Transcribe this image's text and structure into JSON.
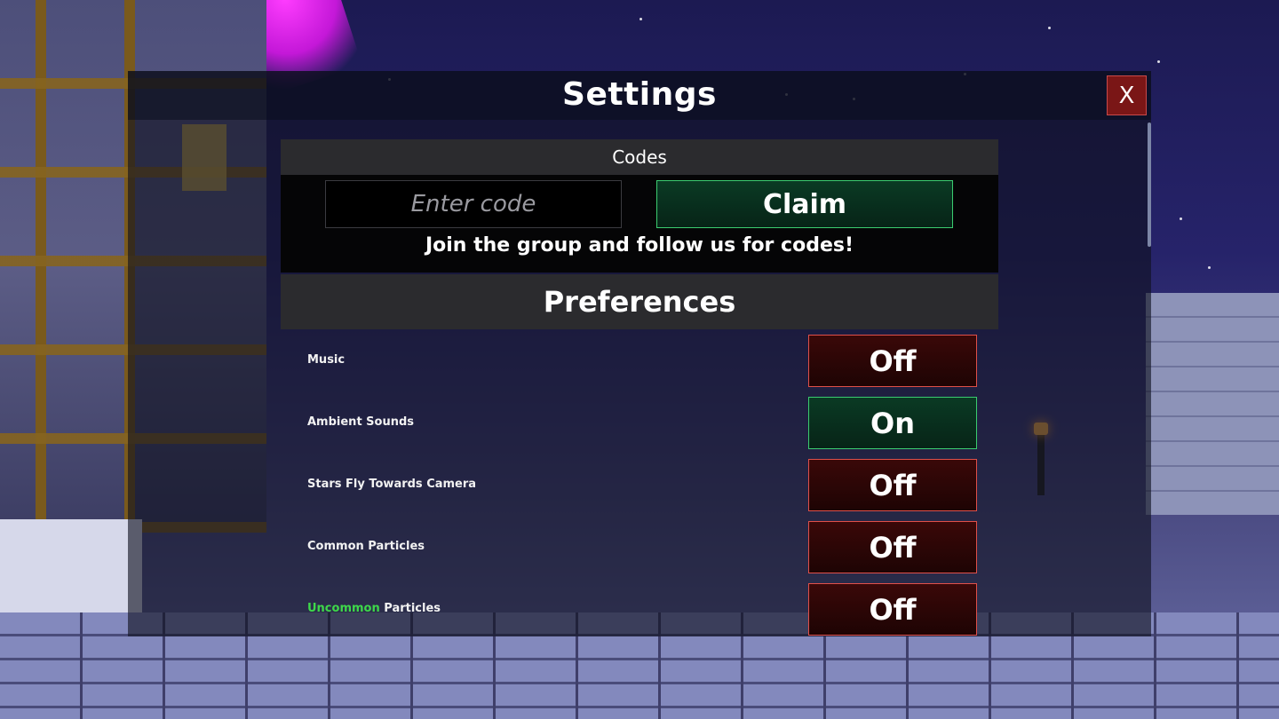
{
  "window": {
    "title": "Settings",
    "close_label": "X"
  },
  "codes": {
    "header": "Codes",
    "input_placeholder": "Enter code",
    "claim_label": "Claim",
    "hint": "Join the group and follow us for codes!"
  },
  "preferences": {
    "header": "Preferences",
    "items": [
      {
        "label": "Music",
        "state": "Off"
      },
      {
        "label": "Ambient Sounds",
        "state": "On"
      },
      {
        "label": "Stars Fly Towards Camera",
        "state": "Off"
      },
      {
        "label": "Common Particles",
        "state": "Off"
      },
      {
        "label_highlight": "Uncommon",
        "label_rest": " Particles",
        "state": "Off"
      }
    ]
  },
  "colors": {
    "on_accent": "#3bcc70",
    "off_accent": "#e0504a",
    "close_bg": "#7a1616",
    "uncommon_green": "#3ed84a"
  }
}
